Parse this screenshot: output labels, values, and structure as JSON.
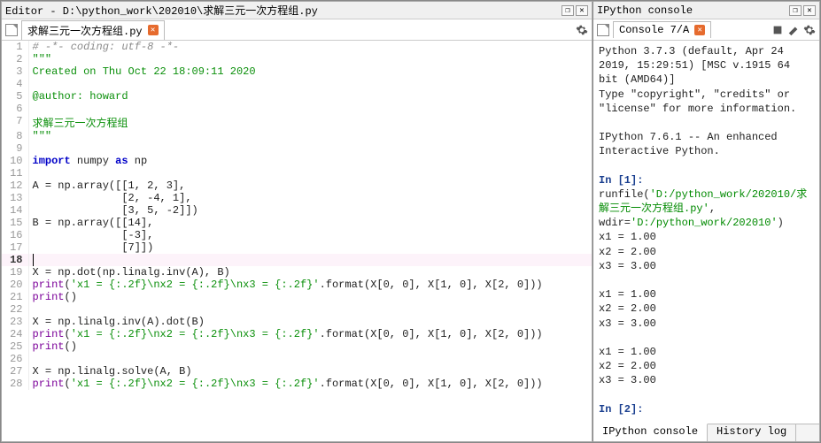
{
  "editor": {
    "title": "Editor - D:\\python_work\\202010\\求解三元一次方程组.py",
    "tab_label": "求解三元一次方程组.py",
    "lines": [
      {
        "n": 1,
        "html": "<span class='c-comment'># -*- coding: utf-8 -*-</span>"
      },
      {
        "n": 2,
        "html": "<span class='c-str-green'>\"\"\"</span>"
      },
      {
        "n": 3,
        "html": "<span class='c-str-green'>Created on Thu Oct 22 18:09:11 2020</span>"
      },
      {
        "n": 4,
        "html": ""
      },
      {
        "n": 5,
        "html": "<span class='c-str-green'>@author: howard</span>"
      },
      {
        "n": 6,
        "html": ""
      },
      {
        "n": 7,
        "html": "<span class='c-str-green'>求解三元一次方程组</span>"
      },
      {
        "n": 8,
        "html": "<span class='c-str-green'>\"\"\"</span>"
      },
      {
        "n": 9,
        "html": ""
      },
      {
        "n": 10,
        "html": "<span class='c-kw'>import</span> <span class='c-text'>numpy</span> <span class='c-kw'>as</span> <span class='c-text'>np</span>"
      },
      {
        "n": 11,
        "html": ""
      },
      {
        "n": 12,
        "html": "<span class='c-text'>A = np.array([[1, 2, 3],</span>"
      },
      {
        "n": 13,
        "html": "<span class='c-text'>              [2, -4, 1],</span>"
      },
      {
        "n": 14,
        "html": "<span class='c-text'>              [3, 5, -2]])</span>"
      },
      {
        "n": 15,
        "html": "<span class='c-text'>B = np.array([[14],</span>"
      },
      {
        "n": 16,
        "html": "<span class='c-text'>              [-3],</span>"
      },
      {
        "n": 17,
        "html": "<span class='c-text'>              [7]])</span>"
      },
      {
        "n": 18,
        "html": "",
        "cursor": true
      },
      {
        "n": 19,
        "html": "<span class='c-text'>X = np.dot(np.linalg.inv(A), B)</span>"
      },
      {
        "n": 20,
        "html": "<span class='c-builtin'>print</span><span class='c-text'>(</span><span class='c-str'>'x1 = {:.2f}\\nx2 = {:.2f}\\nx3 = {:.2f}'</span><span class='c-text'>.format(X[0, 0], X[1, 0], X[2, 0]))</span>"
      },
      {
        "n": 21,
        "html": "<span class='c-builtin'>print</span><span class='c-text'>()</span>"
      },
      {
        "n": 22,
        "html": ""
      },
      {
        "n": 23,
        "html": "<span class='c-text'>X = np.linalg.inv(A).dot(B)</span>"
      },
      {
        "n": 24,
        "html": "<span class='c-builtin'>print</span><span class='c-text'>(</span><span class='c-str'>'x1 = {:.2f}\\nx2 = {:.2f}\\nx3 = {:.2f}'</span><span class='c-text'>.format(X[0, 0], X[1, 0], X[2, 0]))</span>"
      },
      {
        "n": 25,
        "html": "<span class='c-builtin'>print</span><span class='c-text'>()</span>"
      },
      {
        "n": 26,
        "html": ""
      },
      {
        "n": 27,
        "html": "<span class='c-text'>X = np.linalg.solve(A, B)</span>"
      },
      {
        "n": 28,
        "html": "<span class='c-builtin'>print</span><span class='c-text'>(</span><span class='c-str'>'x1 = {:.2f}\\nx2 = {:.2f}\\nx3 = {:.2f}'</span><span class='c-text'>.format(X[0, 0], X[1, 0], X[2, 0]))</span>"
      }
    ]
  },
  "console": {
    "title": "IPython console",
    "tab_label": "Console 7/A",
    "bottom_tabs": {
      "active": "IPython console",
      "other": "History log"
    },
    "banner": [
      "Python 3.7.3 (default, Apr 24 2019, 15:29:51) [MSC v.1915 64 bit (AMD64)]",
      "Type \"copyright\", \"credits\" or \"license\" for more information.",
      "",
      "IPython 7.6.1 -- An enhanced Interactive Python."
    ],
    "in1_prefix": "In [1]:",
    "in1_call": " runfile(",
    "in1_path1": "'D:/python_work/202010/求解三元一次方程组.py'",
    "in1_mid": ", wdir=",
    "in1_path2": "'D:/python_work/202010'",
    "in1_suffix": ")",
    "outputs": [
      "x1 = 1.00",
      "x2 = 2.00",
      "x3 = 3.00",
      "",
      "x1 = 1.00",
      "x2 = 2.00",
      "x3 = 3.00",
      "",
      "x1 = 1.00",
      "x2 = 2.00",
      "x3 = 3.00",
      ""
    ],
    "in2_prefix": "In [2]:",
    "in2_rest": " "
  },
  "icons": {
    "restore": "❐",
    "close": "✕",
    "tab_close": "✕"
  }
}
